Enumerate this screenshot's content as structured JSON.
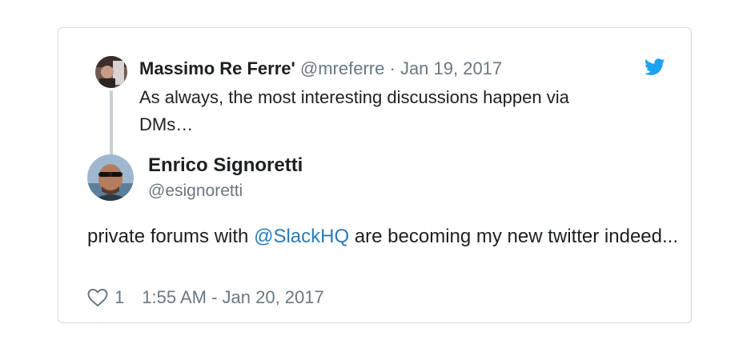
{
  "quoted_tweet": {
    "author_name": "Massimo Re Ferre'",
    "author_handle": "@mreferre",
    "separator": "·",
    "date": "Jan 19, 2017",
    "text": "As always, the most interesting discussions happen via DMs…"
  },
  "tweet": {
    "author_name": "Enrico Signoretti",
    "author_handle": "@esignoretti",
    "text_before": "private forums with ",
    "mention": "@SlackHQ",
    "text_after": " are becoming my new twitter indeed...",
    "like_count": "1",
    "timestamp": "1:55 AM - Jan 20, 2017"
  },
  "icons": {
    "brand": "twitter-bird-icon",
    "like": "heart-outline-icon"
  },
  "colors": {
    "brand_blue": "#1da1f2",
    "link_blue": "#2b7bb9",
    "muted_text": "#697882",
    "border": "#d6dadd"
  }
}
